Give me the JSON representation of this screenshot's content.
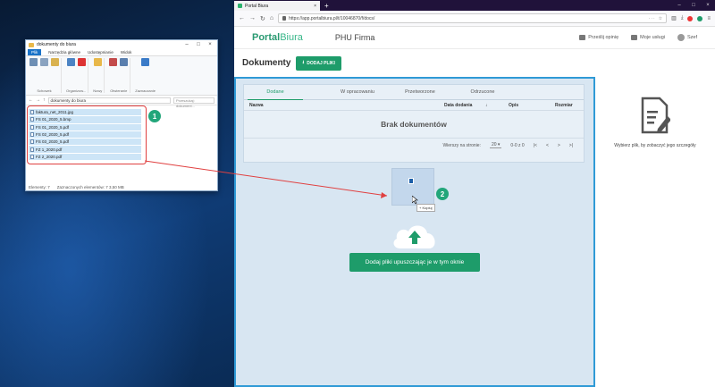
{
  "explorer": {
    "title": "dokumenty do biura",
    "tabs": [
      "Plik",
      "Narzędzia główne",
      "Udostępnianie",
      "Widok"
    ],
    "ribbon_groups": [
      "Schowek",
      "Organizow...",
      "Nowy",
      "Otwieranie",
      "Zaznaczanie"
    ],
    "ribbon_items": [
      "Przypnij do paska Szybki dostęp",
      "Kopiuj",
      "Wklej",
      "Nowy",
      "Właściwości",
      "Zaznaczanie"
    ],
    "address": "dokumenty do biura",
    "search_placeholder": "Przeszukaj: dokument...",
    "files": [
      "faktura_net_2011.jpg",
      "FS 01_2020_5.bmp",
      "FS 01_2020_5.pdf",
      "FS 02_2020_5.pdf",
      "FS 03_2020_5.pdf",
      "FZ 1_2020.pdf",
      "FZ 2_2020.pdf"
    ],
    "status_items": "Elementy: 7",
    "status_selected": "Zaznaczonych elementów: 7  3,50 MB",
    "badge": "1"
  },
  "browser": {
    "tab_title": "Portal Biura",
    "url": "https://app.portalbiura.pl/t/10046870/f/docs/",
    "new_tab": "+"
  },
  "app": {
    "logo_portal": "Portal",
    "logo_biura": "Biura",
    "company": "PHU Firma",
    "header_links": [
      "Prześlij opinię",
      "Moje usługi",
      "Szef"
    ],
    "page_title": "Dokumenty",
    "add_button": "DODAJ PLIKI",
    "tabs": [
      "Dodane",
      "W opracowaniu",
      "Przetworzone",
      "Odrzucone"
    ],
    "columns": [
      "Nazwa",
      "Data dodania",
      "Opis",
      "Rozmiar"
    ],
    "empty_message": "Brak dokumentów",
    "rows_per_page_label": "Wierszy na stronie:",
    "rows_per_page": "20",
    "range": "0-0 z 0",
    "drop_button": "Dodaj pliki upuszczając je w tym oknie",
    "copy_tip": "Kopiuj",
    "badge": "2",
    "right_hint": "Wybierz plik, by zobaczyć jego szczegóły"
  },
  "colors": {
    "accent": "#1e9c6a",
    "drop_border": "#2f9ad6",
    "annotation": "#e04040"
  }
}
